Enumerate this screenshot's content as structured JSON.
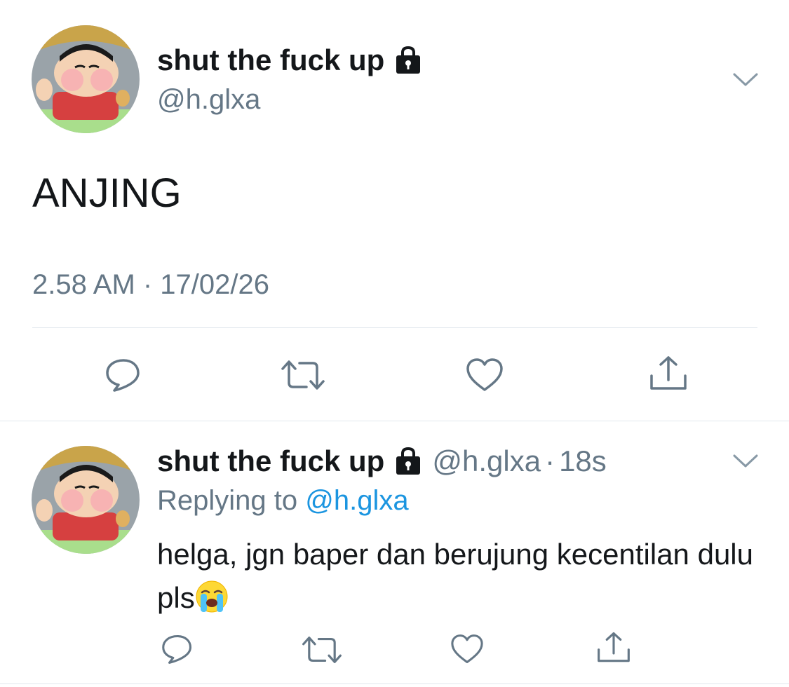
{
  "main_tweet": {
    "display_name": "shut the fuck up",
    "handle": "@h.glxa",
    "text": "ANJING",
    "timestamp": "2.58 AM · 17/02/26",
    "icons": {
      "lock": "lock-icon",
      "chevron": "chevron-down-icon"
    },
    "actions": [
      "reply-icon",
      "retweet-icon",
      "like-icon",
      "share-icon"
    ]
  },
  "reply_tweet": {
    "display_name": "shut the fuck up",
    "handle": "@h.glxa",
    "separator": "·",
    "time": "18s",
    "replying_prefix": "Replying to",
    "replying_to": "@h.glxa",
    "text": "helga, jgn baper dan berujung kecentilan dulu pls",
    "emoji": "loudly-crying-face",
    "actions": [
      "reply-icon",
      "retweet-icon",
      "like-icon",
      "share-icon"
    ]
  },
  "colors": {
    "text": "#14171a",
    "secondary": "#657786",
    "link": "#1b95e0",
    "divider": "#e1e8ed"
  }
}
